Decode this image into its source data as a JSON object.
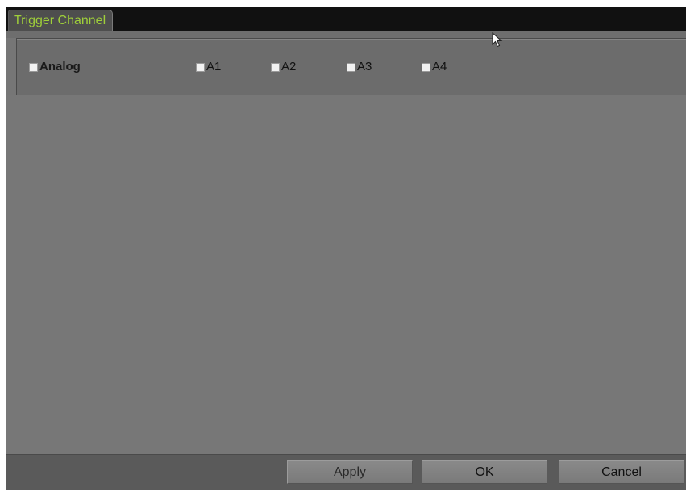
{
  "window": {
    "tab_label": "Trigger Channel"
  },
  "channels": {
    "group": {
      "label": "Analog",
      "checked": false
    },
    "items": [
      {
        "label": "A1",
        "checked": false
      },
      {
        "label": "A2",
        "checked": false
      },
      {
        "label": "A3",
        "checked": false
      },
      {
        "label": "A4",
        "checked": false
      }
    ]
  },
  "buttons": {
    "apply": "Apply",
    "ok": "OK",
    "cancel": "Cancel"
  },
  "colors": {
    "tab_text": "#9fcf3a",
    "background": "#767676",
    "title_bar": "#111111",
    "checkbox_fill": "#f2f2f2"
  }
}
